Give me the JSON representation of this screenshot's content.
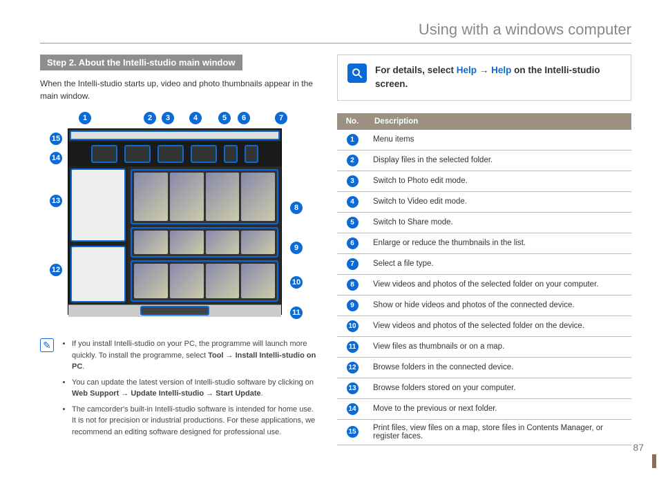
{
  "header": {
    "title": "Using with a windows computer"
  },
  "left": {
    "step_bar": "Step 2. About the Intelli-studio main window",
    "intro": "When the Intelli-studio starts up, video and photo thumbnails appear in the main window.",
    "notes": [
      {
        "pre": "If you install Intelli-studio on your PC, the programme will launch more quickly. To install the programme, select ",
        "bold1": "Tool",
        "arrow1": " → ",
        "bold2": "Install Intelli-studio on PC",
        "post": "."
      },
      {
        "pre": "You can update the latest version of Intelli-studio software by clicking on ",
        "bold1": "Web Support ",
        "arrow1": " → ",
        "bold2": "Update Intelli-studio",
        "arrow2": " → ",
        "bold3": "Start Update",
        "post": "."
      },
      {
        "pre": "The camcorder's built-in Intelli-studio software is intended for home use. It is not for precision or industrial productions. For these applications, we recommend an editing software designed for professional use.",
        "bold1": "",
        "post": ""
      }
    ]
  },
  "right": {
    "help_pre": "For details, select ",
    "help_link1": "Help",
    "help_arrow": " → ",
    "help_link2": "Help",
    "help_post": " on the Intelli-studio screen.",
    "table_header_no": "No.",
    "table_header_desc": "Description",
    "rows": [
      "Menu items",
      "Display files in the selected folder.",
      "Switch to Photo edit mode.",
      "Switch to Video edit mode.",
      "Switch to Share mode.",
      "Enlarge or reduce the thumbnails in the list.",
      "Select a file type.",
      "View videos and photos of the selected folder on your computer.",
      "Show or hide videos and photos of the connected device.",
      "View videos and photos of the selected folder on the device.",
      "View files as thumbnails or on a map.",
      "Browse folders in the connected device.",
      "Browse folders stored on your computer.",
      "Move to the previous or next folder.",
      "Print files, view files on a map, store files in Contents Manager, or register faces."
    ]
  },
  "page_number": "87",
  "callouts_top": [
    "1",
    "2",
    "3",
    "4",
    "5",
    "6",
    "7"
  ],
  "callouts_right": [
    "8",
    "9",
    "10",
    "11"
  ],
  "callouts_left": [
    "15",
    "14",
    "13",
    "12"
  ]
}
